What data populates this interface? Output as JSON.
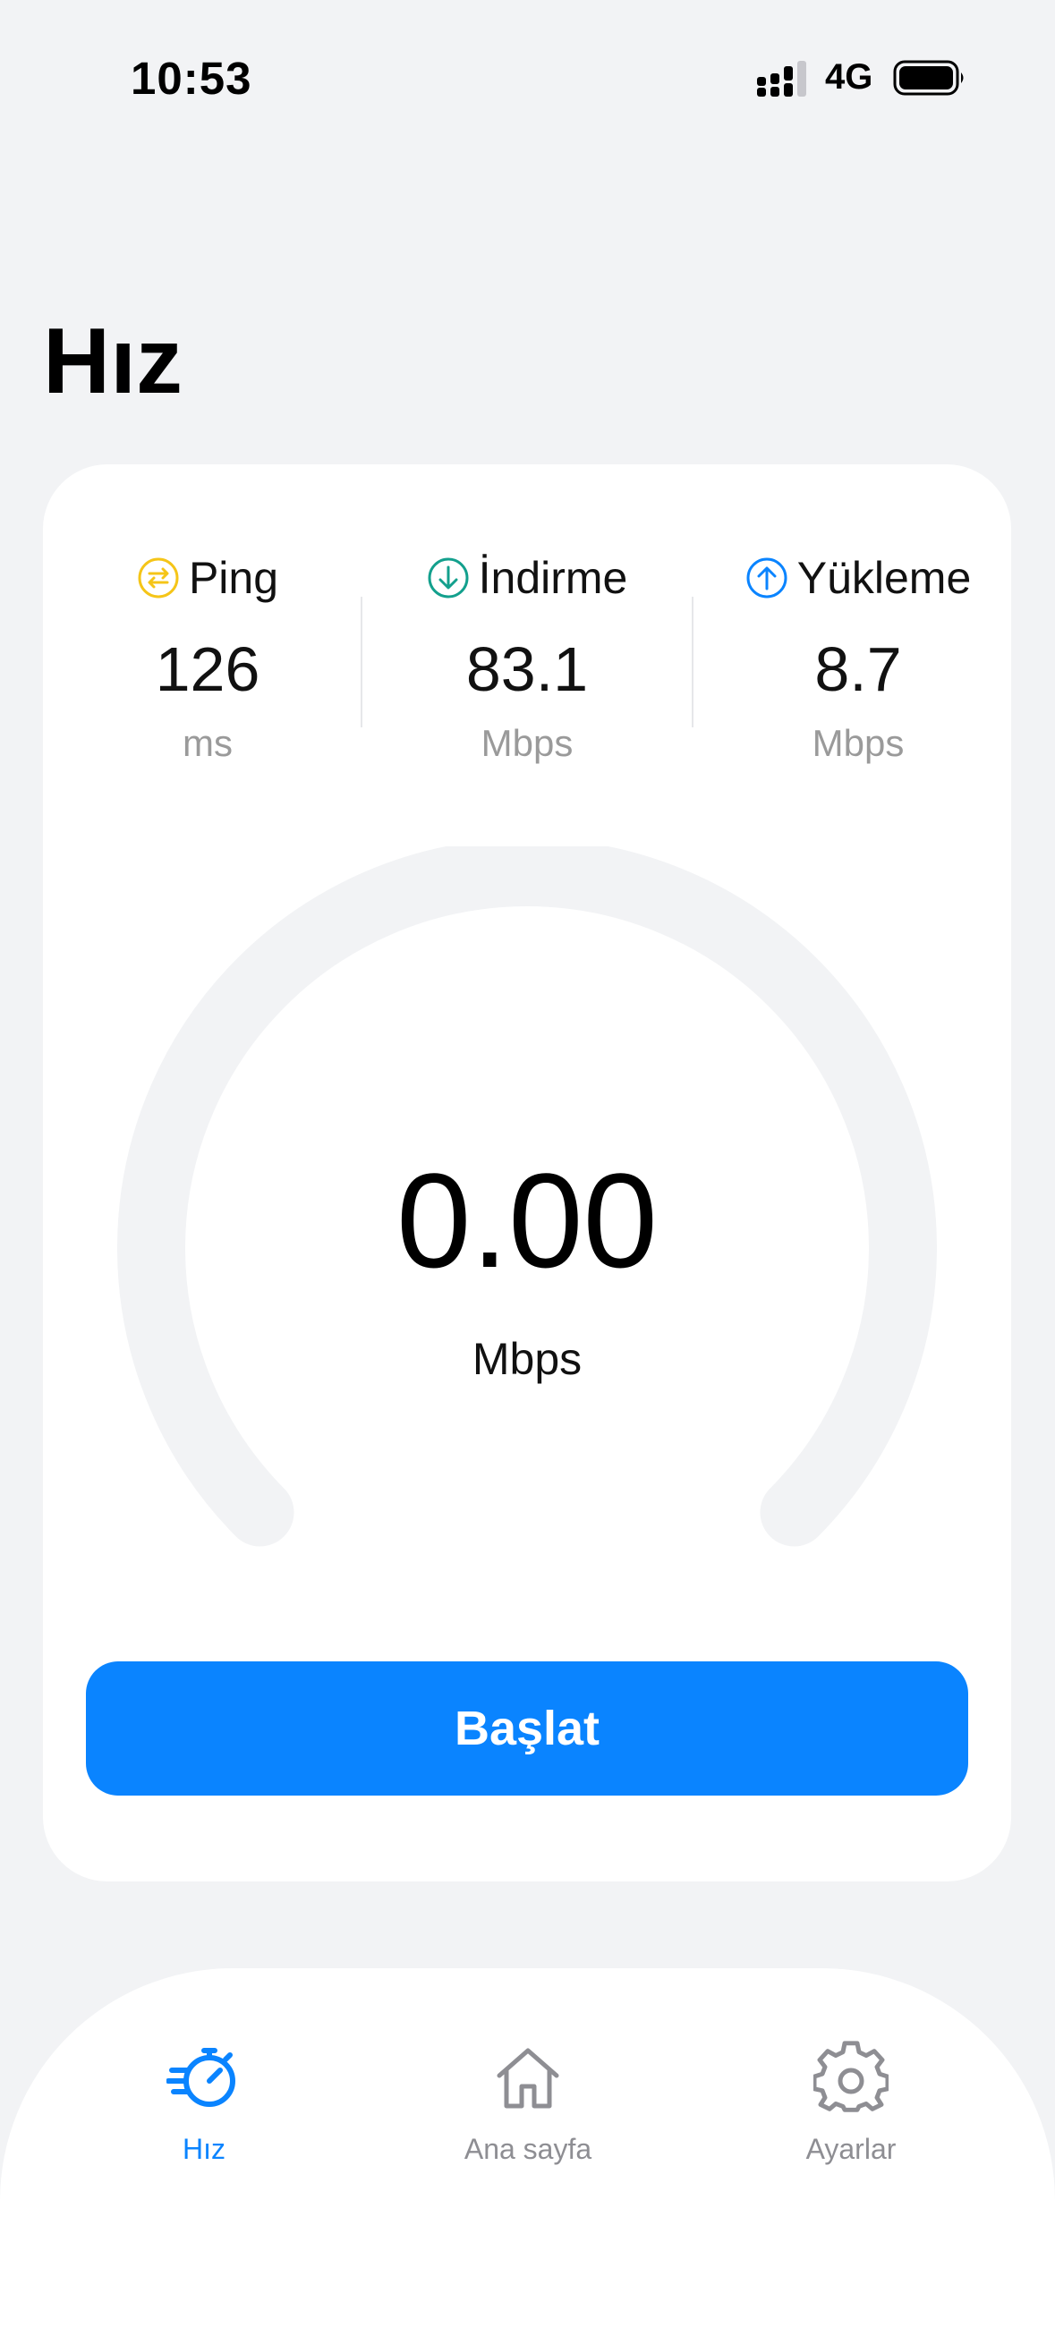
{
  "status_bar": {
    "time": "10:53",
    "network": "4G",
    "icons": [
      "signal-icon",
      "battery-icon"
    ]
  },
  "header": {
    "title": "Hız"
  },
  "metrics": [
    {
      "label": "Ping",
      "value": "126",
      "unit": "ms",
      "icon": "ping-icon",
      "color": "#F5C518"
    },
    {
      "label": "İndirme",
      "value": "83.1",
      "unit": "Mbps",
      "icon": "download-icon",
      "color": "#13A08D"
    },
    {
      "label": "Yükleme",
      "value": "8.7",
      "unit": "Mbps",
      "icon": "upload-icon",
      "color": "#0A84FF"
    }
  ],
  "gauge": {
    "value": "0.00",
    "unit": "Mbps",
    "progress": 0,
    "track_color": "#F2F3F5"
  },
  "start_button": {
    "label": "Başlat",
    "color": "#0A84FF"
  },
  "tab_bar": {
    "tabs": [
      {
        "label": "Hız",
        "icon": "speedometer-icon",
        "active": true
      },
      {
        "label": "Ana sayfa",
        "icon": "home-icon",
        "active": false
      },
      {
        "label": "Ayarlar",
        "icon": "gear-icon",
        "active": false
      }
    ],
    "active_color": "#0A84FF",
    "inactive_color": "#8E8E93"
  }
}
